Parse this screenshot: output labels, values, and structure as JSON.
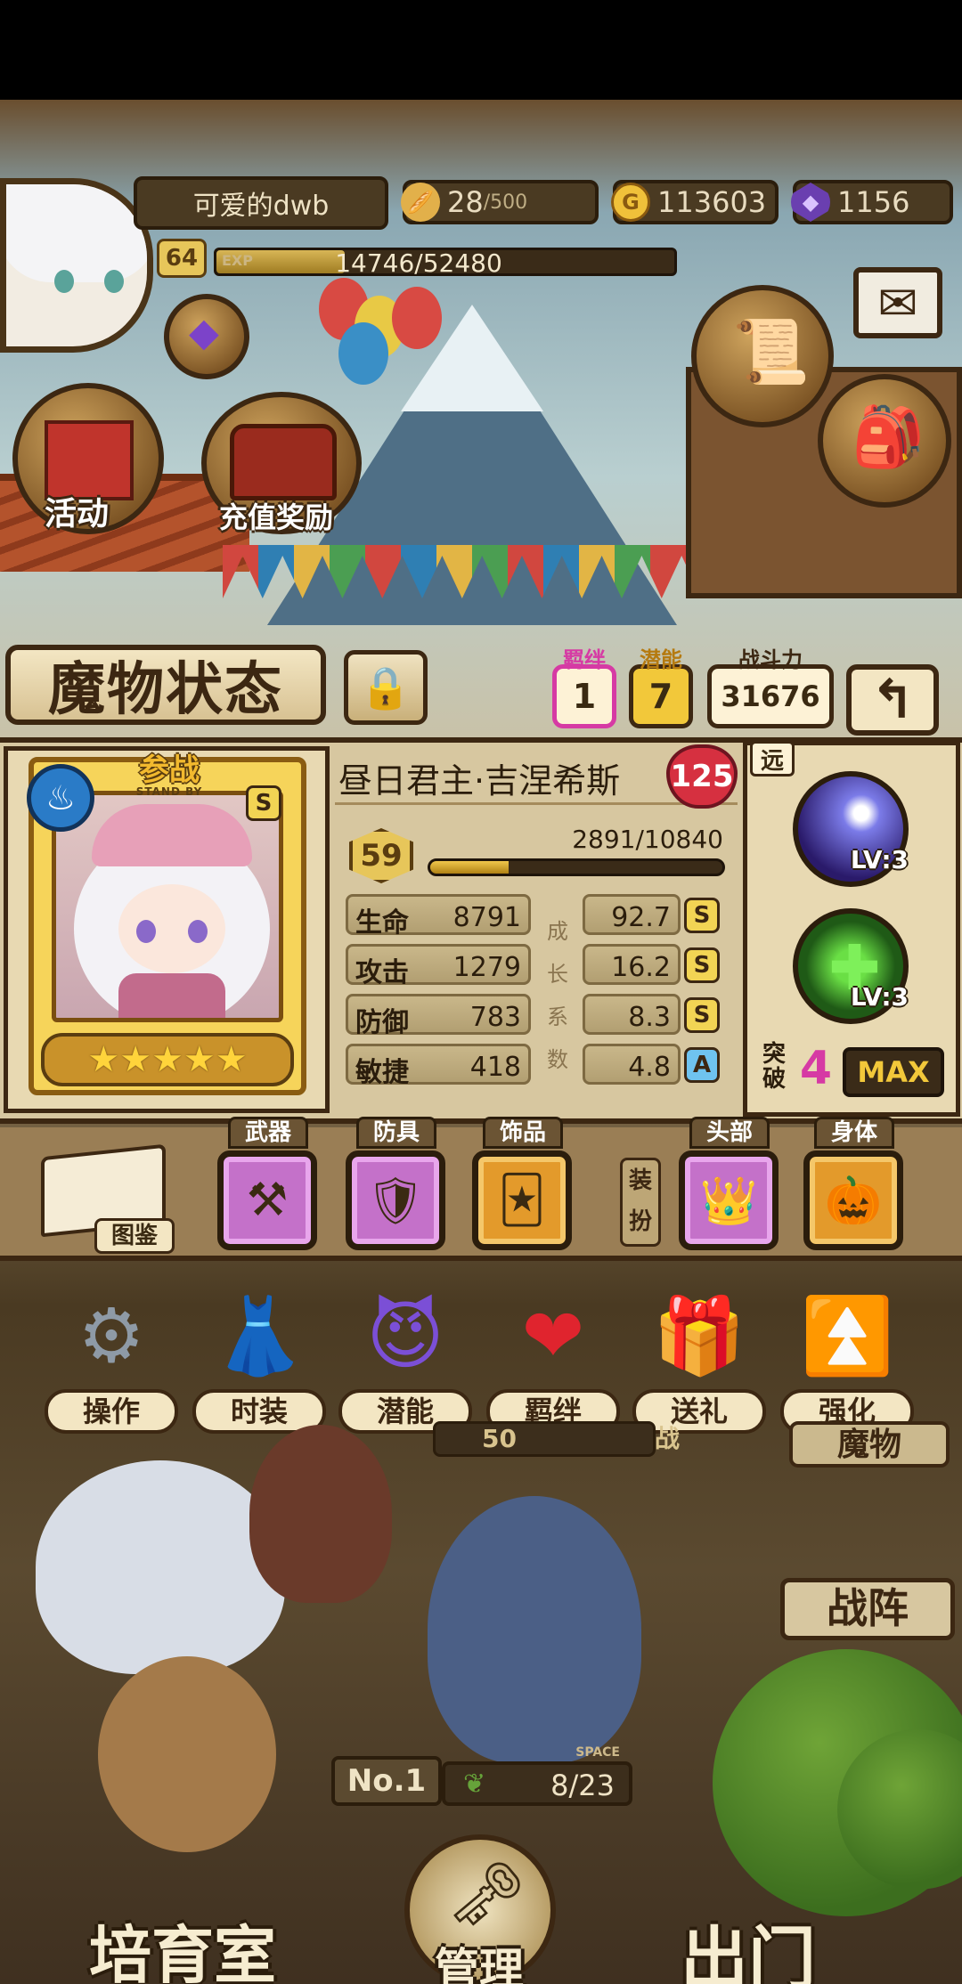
{
  "player": {
    "name": "可爱的dwb",
    "level": "64",
    "exp_label": "EXP",
    "exp_text": "14746/52480",
    "exp_ratio": 0.281
  },
  "resources": {
    "stamina": "28",
    "stamina_max": "/500",
    "gold": "113603",
    "gems": "1156"
  },
  "top_buttons": {
    "event": "活动",
    "recharge_reward": "充值奖励"
  },
  "header": {
    "title": "魔物状态",
    "bond_label": "羁绊",
    "bond_value": "1",
    "potential_label": "潜能",
    "potential_value": "7",
    "power_label": "战斗力",
    "power_value": "31676"
  },
  "monster": {
    "status_cn": "参战",
    "status_en": "STAND BY",
    "rank": "S",
    "stars": 5,
    "name": "昼日君主·吉涅希斯",
    "heart_value": "125",
    "level": "59",
    "level_exp_text": "2891/10840",
    "level_exp_ratio": 0.267,
    "stats": [
      {
        "key": "生命",
        "value": "8791",
        "growth": "92.7",
        "grade": "S"
      },
      {
        "key": "攻击",
        "value": "1279",
        "growth": "16.2",
        "grade": "S"
      },
      {
        "key": "防御",
        "value": "783",
        "growth": "8.3",
        "grade": "S"
      },
      {
        "key": "敏捷",
        "value": "418",
        "growth": "4.8",
        "grade": "A"
      }
    ],
    "growth_chars": [
      "成",
      "长",
      "系",
      "数"
    ],
    "range": "远",
    "skills": [
      {
        "level": "LV:3"
      },
      {
        "level": "LV:3"
      }
    ],
    "breakthrough_label": "突破",
    "breakthrough_value": "4",
    "max_label": "MAX"
  },
  "equipment": {
    "codex": "图鉴",
    "weapon": "武器",
    "armor": "防具",
    "accessory": "饰品",
    "dress_up": "装扮",
    "head": "头部",
    "body": "身体"
  },
  "actions": [
    "操作",
    "时装",
    "潜能",
    "羁绊",
    "送礼",
    "强化"
  ],
  "lower": {
    "monster_tab": "魔物",
    "formation": "战阵",
    "no_label": "No.",
    "no_value": "1",
    "space_label": "SPACE",
    "space_value": "8/23",
    "nursery": "培育室",
    "manage": "管理",
    "go_out": "出门",
    "partial_level": "50",
    "partial_tag": "战"
  }
}
